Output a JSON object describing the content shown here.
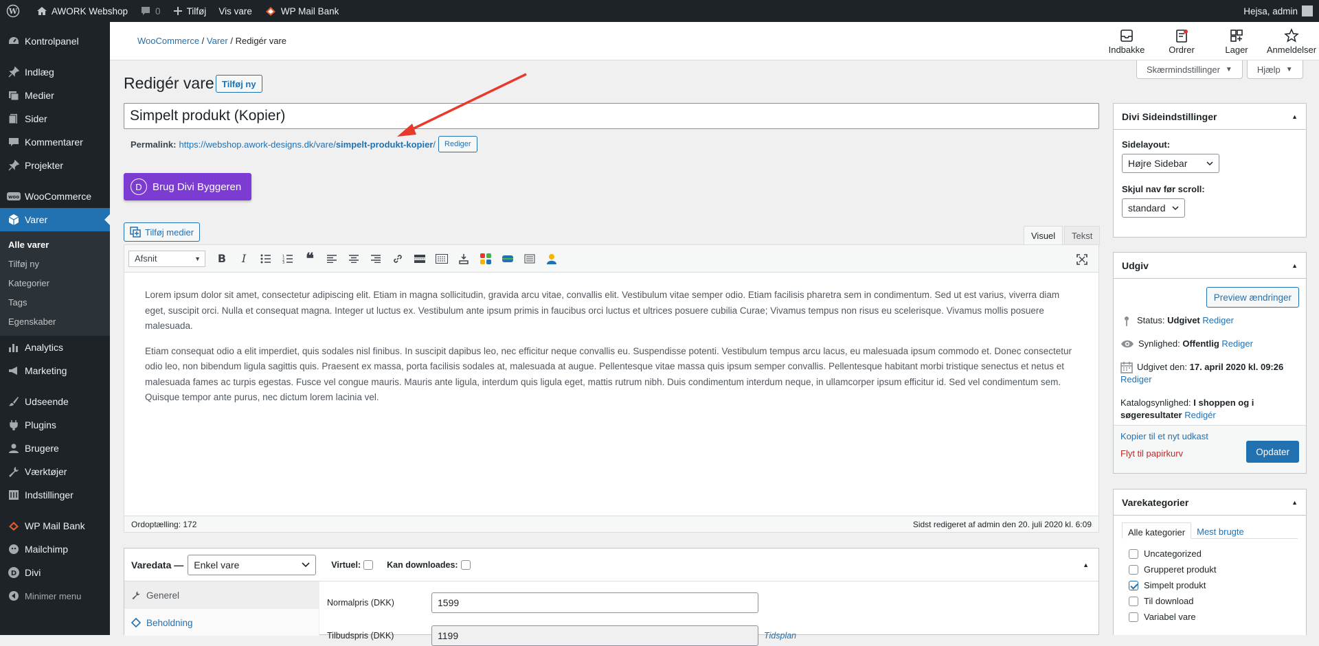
{
  "adminbar": {
    "site_name": "AWORK Webshop",
    "comments": "0",
    "new": "Tilføj",
    "view": "Vis vare",
    "mailbank": "WP Mail Bank",
    "greeting": "Hejsa, admin"
  },
  "sidebar": {
    "items": [
      {
        "label": "Kontrolpanel",
        "icon": "dashboard-icon"
      },
      {
        "label": "Indlæg",
        "icon": "pin-icon"
      },
      {
        "label": "Medier",
        "icon": "media-icon"
      },
      {
        "label": "Sider",
        "icon": "page-icon"
      },
      {
        "label": "Kommentarer",
        "icon": "comment-icon"
      },
      {
        "label": "Projekter",
        "icon": "pin-icon"
      },
      {
        "label": "WooCommerce",
        "icon": "woo-icon"
      },
      {
        "label": "Varer",
        "icon": "product-icon"
      },
      {
        "label": "Analytics",
        "icon": "chart-icon"
      },
      {
        "label": "Marketing",
        "icon": "megaphone-icon"
      },
      {
        "label": "Udseende",
        "icon": "brush-icon"
      },
      {
        "label": "Plugins",
        "icon": "plug-icon"
      },
      {
        "label": "Brugere",
        "icon": "user-icon"
      },
      {
        "label": "Værktøjer",
        "icon": "wrench-icon"
      },
      {
        "label": "Indstillinger",
        "icon": "settings-icon"
      },
      {
        "label": "WP Mail Bank",
        "icon": "mailbank-icon"
      },
      {
        "label": "Mailchimp",
        "icon": "mailchimp-icon"
      },
      {
        "label": "Divi",
        "icon": "divi-icon"
      }
    ],
    "submenu": [
      "Alle varer",
      "Tilføj ny",
      "Kategorier",
      "Tags",
      "Egenskaber"
    ],
    "collapse": "Minimer menu"
  },
  "breadcrumb": {
    "root": "WooCommerce",
    "parent": "Varer",
    "current": "Redigér vare"
  },
  "wcnav": [
    "Indbakke",
    "Ordrer",
    "Lager",
    "Anmeldelser"
  ],
  "screen_options": "Skærmindstillinger",
  "help": "Hjælp",
  "page_title": "Redigér vare",
  "add_new": "Tilføj ny",
  "post_title": "Simpelt produkt (Kopier)",
  "permalink": {
    "label": "Permalink:",
    "url_base": "https://webshop.awork-designs.dk/vare/",
    "slug": "simpelt-produkt-kopier",
    "trail": "/",
    "edit": "Rediger"
  },
  "divi_button": "Brug Divi Byggeren",
  "add_media": "Tilføj medier",
  "editor": {
    "tab_visual": "Visuel",
    "tab_text": "Tekst",
    "format": "Afsnit",
    "paragraphs": [
      "Lorem ipsum dolor sit amet, consectetur adipiscing elit. Etiam in magna sollicitudin, gravida arcu vitae, convallis elit. Vestibulum vitae semper odio. Etiam facilisis pharetra sem in condimentum. Sed ut est varius, viverra diam eget, suscipit orci. Nulla et consequat magna. Integer ut luctus ex. Vestibulum ante ipsum primis in faucibus orci luctus et ultrices posuere cubilia Curae; Vivamus tempus non risus eu scelerisque. Vivamus mollis posuere malesuada.",
      "Etiam consequat odio a elit imperdiet, quis sodales nisl finibus. In suscipit dapibus leo, nec efficitur neque convallis eu. Suspendisse potenti. Vestibulum tempus arcu lacus, eu malesuada ipsum commodo et. Donec consectetur odio leo, non bibendum ligula sagittis quis. Praesent ex massa, porta facilisis sodales at, malesuada at augue. Pellentesque vitae massa quis ipsum semper convallis. Pellentesque habitant morbi tristique senectus et netus et malesuada fames ac turpis egestas. Fusce vel congue mauris. Mauris ante ligula, interdum quis ligula eget, mattis rutrum nibh. Duis condimentum interdum neque, in ullamcorper ipsum efficitur id. Sed vel condimentum sem. Quisque tempor ante purus, nec dictum lorem lacinia vel."
    ],
    "word_count": "Ordoptælling: 172",
    "last_edited": "Sidst redigeret af admin den 20. juli 2020 kl. 6:09"
  },
  "varedata": {
    "label": "Varedata —",
    "type": "Enkel vare",
    "virtual": "Virtuel:",
    "downloadable": "Kan downloades:",
    "tabs": [
      "Generel",
      "Beholdning"
    ],
    "regular_price_label": "Normalpris (DKK)",
    "regular_price": "1599",
    "sale_price_label": "Tilbudspris (DKK)",
    "sale_price": "1199",
    "schedule": "Tidsplan"
  },
  "divi_box": {
    "title": "Divi Sideindstillinger",
    "layout_label": "Sidelayout:",
    "layout_value": "Højre Sidebar",
    "nav_label": "Skjul nav før scroll:",
    "nav_value": "standard"
  },
  "publish": {
    "title": "Udgiv",
    "preview": "Preview ændringer",
    "status_label": "Status:",
    "status_value": "Udgivet",
    "visibility_label": "Synlighed:",
    "visibility_value": "Offentlig",
    "published_label": "Udgivet den:",
    "published_value": "17. april 2020 kl. 09:26",
    "catalog_label": "Katalogsynlighed:",
    "catalog_value": "I shoppen og i søgeresultater",
    "edit": "Rediger",
    "edit2": "Redigér",
    "copy": "Kopier til et nyt udkast",
    "trash": "Flyt til papirkurv",
    "update": "Opdater"
  },
  "categories": {
    "title": "Varekategorier",
    "tab_all": "Alle kategorier",
    "tab_most": "Mest brugte",
    "items": [
      {
        "label": "Uncategorized",
        "checked": false
      },
      {
        "label": "Grupperet produkt",
        "checked": false
      },
      {
        "label": "Simpelt produkt",
        "checked": true
      },
      {
        "label": "Til download",
        "checked": false
      },
      {
        "label": "Variabel vare",
        "checked": false
      }
    ]
  },
  "colors": {
    "accent": "#2271b1",
    "adminbar": "#1d2327",
    "divi": "#7c3bd1",
    "trash": "#b32d2e",
    "arrow": "#e8392b"
  }
}
